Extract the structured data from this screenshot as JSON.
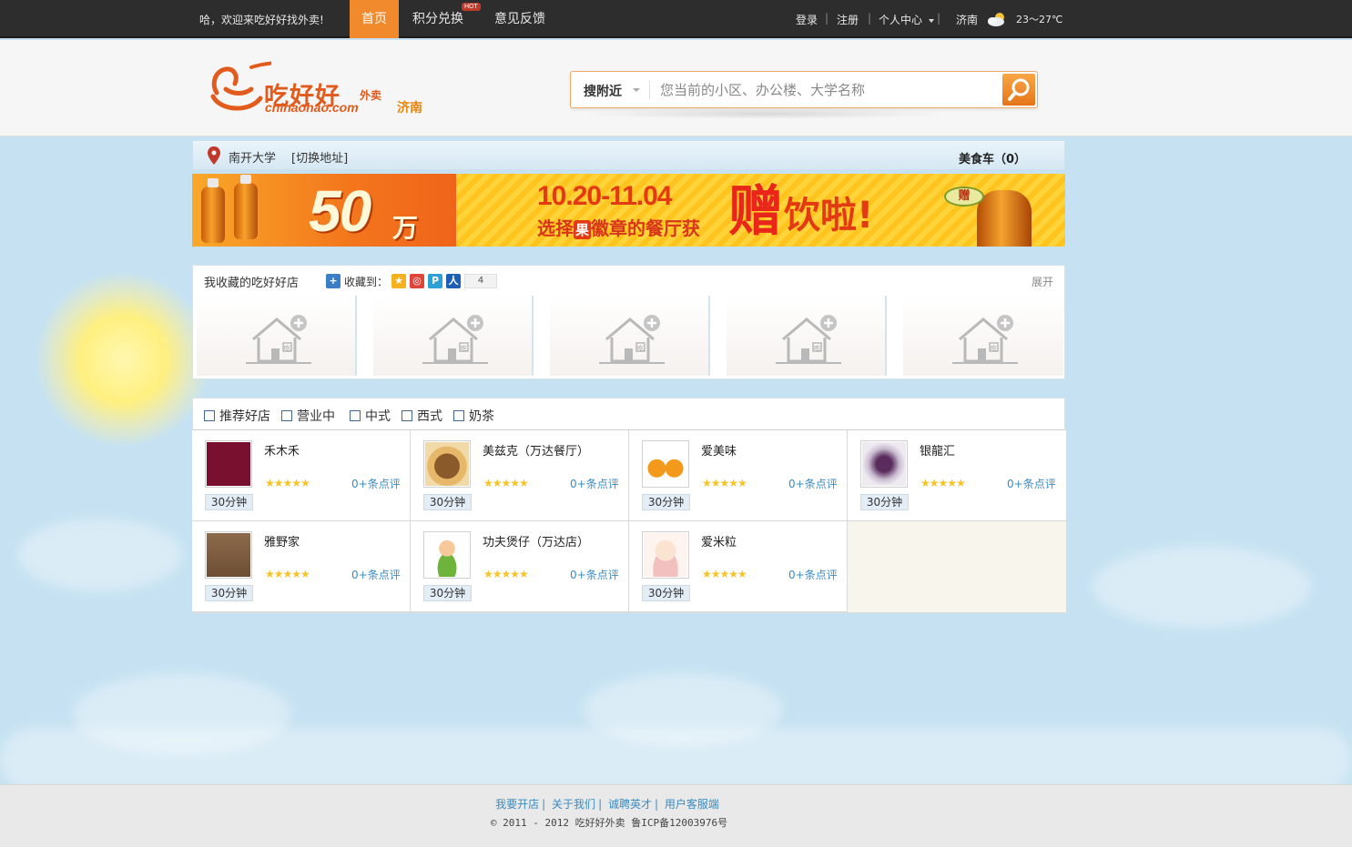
{
  "topbar": {
    "welcome": "哈，欢迎来吃好好找外卖!",
    "nav": [
      {
        "label": "首页",
        "active": true
      },
      {
        "label": "积分兑换",
        "badge": "HOT"
      },
      {
        "label": "意见反馈"
      }
    ],
    "login": "登录",
    "register": "注册",
    "user_center": "个人中心",
    "city": "济南",
    "weather_icon": "partly-cloudy-icon",
    "temperature": "23～27℃"
  },
  "header": {
    "logo_text": "吃好好",
    "logo_sub": "外卖",
    "logo_domain": "chihaohao.com",
    "logo_city": "济南",
    "search": {
      "scope": "搜附近",
      "placeholder": "您当前的小区、办公楼、大学名称",
      "value": ""
    }
  },
  "address": {
    "name": "南开大学",
    "switch_label": "[切换地址]",
    "cart_label": "美食车（0）"
  },
  "banner": {
    "amount": "50",
    "unit": "万",
    "dates": "10.20-11.04",
    "line_pre": "选择",
    "line_badge": "果",
    "line_post": "徽章的餐厅获",
    "zeng": "赠",
    "yin": "饮啦!",
    "leaf_text": "赠"
  },
  "favorites": {
    "title": "我收藏的吃好好店",
    "collect_label": "收藏到：",
    "share_count": "4",
    "expand_label": "展开",
    "slot_icon": "house-plus-icon",
    "slot_glyph": "吃",
    "slots": 5
  },
  "filters": [
    "推荐好店",
    "营业中",
    "中式",
    "西式",
    "奶茶"
  ],
  "restaurants": [
    {
      "name": "禾木禾",
      "stars": "★★★★★",
      "reviews": "0+条点评",
      "time": "30分钟"
    },
    {
      "name": "美兹克（万达餐厅）",
      "stars": "★★★★★",
      "reviews": "0+条点评",
      "time": "30分钟"
    },
    {
      "name": "爱美味",
      "stars": "★★★★★",
      "reviews": "0+条点评",
      "time": "30分钟"
    },
    {
      "name": "银龍汇",
      "stars": "★★★★★",
      "reviews": "0+条点评",
      "time": "30分钟"
    },
    {
      "name": "雅野家",
      "stars": "★★★★★",
      "reviews": "0+条点评",
      "time": "30分钟"
    },
    {
      "name": "功夫煲仔（万达店）",
      "stars": "★★★★★",
      "reviews": "0+条点评",
      "time": "30分钟"
    },
    {
      "name": "爱米粒",
      "stars": "★★★★★",
      "reviews": "0+条点评",
      "time": "30分钟"
    }
  ],
  "footer": {
    "links": [
      "我要开店",
      "关于我们",
      "诚聘英才",
      "用户客服端"
    ],
    "copyright": "© 2011 - 2012 吃好好外卖 鲁ICP备12003976号"
  },
  "colors": {
    "accent": "#f08a2c",
    "link": "#3a8bbf",
    "topbar": "#2d2d2d",
    "page_bg": "#c6e2f2"
  }
}
